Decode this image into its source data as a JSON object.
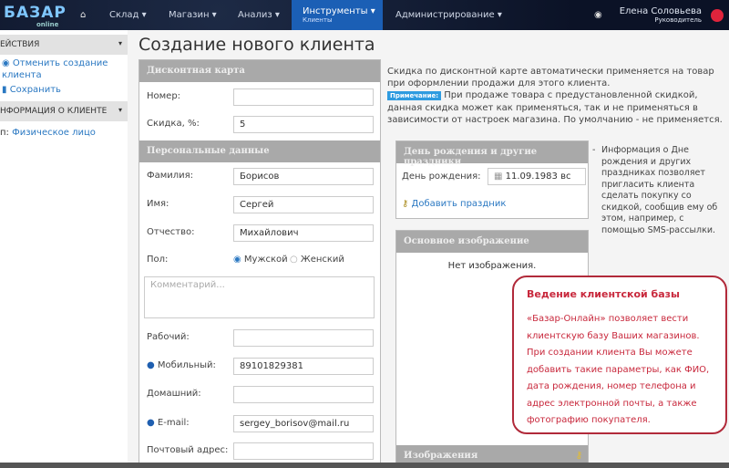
{
  "nav": {
    "logo": "БАЗАР",
    "logo_sub": "online",
    "items": [
      "Склад ▾",
      "Магазин ▾",
      "Анализ ▾"
    ],
    "active": "Инструменты ▾",
    "active_sub": "Клиенты",
    "admin": "Администрирование ▾",
    "user_name": "Елена Соловьева",
    "user_role": "Руководитель"
  },
  "sidebar": {
    "actions_title": "ЕЙСТВИЯ",
    "cancel": "Отменить создание клиента",
    "save": "Сохранить",
    "info_title": "НФОРМАЦИЯ О КЛИЕНТЕ",
    "type_label": "п:",
    "type_value": "Физическое лицо"
  },
  "page": {
    "title": "Создание нового клиента"
  },
  "discount": {
    "title": "Дисконтная карта",
    "number_label": "Номер:",
    "number_value": "",
    "discount_label": "Скидка, %:",
    "discount_value": "5"
  },
  "personal": {
    "title": "Персональные данные",
    "last_name_label": "Фамилия:",
    "last_name": "Борисов",
    "first_name_label": "Имя:",
    "first_name": "Сергей",
    "patronymic_label": "Отчество:",
    "patronymic": "Михайлович",
    "gender_label": "Пол:",
    "gender_male": "Мужской",
    "gender_female": "Женский",
    "gender_selected": "Мужской",
    "comment_placeholder": "Комментарий...",
    "work_label": "Рабочий:",
    "work": "",
    "mobile_label": "Мобильный:",
    "mobile": "89101829381",
    "home_label": "Домашний:",
    "home": "",
    "email_label": "E-mail:",
    "email": "sergey_borisov@mail.ru",
    "address_label": "Почтовый адрес:",
    "address": ""
  },
  "discount_note": {
    "text": "Скидка по дисконтной карте автоматически применяется на товар при оформлении продажи для этого клиента.",
    "tag": "Примечание:",
    "note": "При продаже товара с предустановленной скидкой, данная скидка может как применяться, так и не применяться в зависимости от настроек магазина. По умолчанию - не применяется."
  },
  "birthday": {
    "title": "День рождения и другие праздники",
    "label": "День рождения:",
    "value": "11.09.1983 вс",
    "add_holiday": "Добавить праздник",
    "info": "Информация о Дне рождения и других праздниках позволяет пригласить клиента сделать покупку со скидкой, сообщив ему об этом, например, с помощью SMS-рассылки."
  },
  "main_image": {
    "title": "Основное изображение",
    "empty": "Нет изображения."
  },
  "images": {
    "title": "Изображения"
  },
  "callout": {
    "title": "Ведение клиентской базы",
    "body": "«Базар-Онлайн» позволяет вести клиентскую базу Ваших магазинов. При создании клиента Вы можете добавить такие параметры, как ФИО, дата рождения, номер телефона и адрес электронной почты, а также фотографию покупателя."
  }
}
